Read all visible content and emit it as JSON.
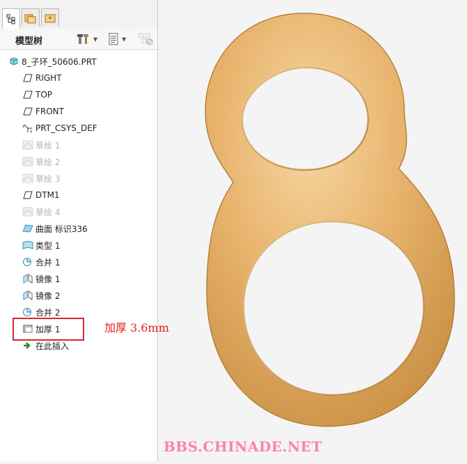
{
  "panel": {
    "tree_title": "模型树"
  },
  "tree": {
    "items": [
      {
        "label": "8_子环_50606.PRT",
        "icon": "part-icon",
        "dim": false
      },
      {
        "label": "RIGHT",
        "icon": "datum-plane-icon",
        "dim": false
      },
      {
        "label": "TOP",
        "icon": "datum-plane-icon",
        "dim": false
      },
      {
        "label": "FRONT",
        "icon": "datum-plane-icon",
        "dim": false
      },
      {
        "label": "PRT_CSYS_DEF",
        "icon": "csys-icon",
        "dim": false
      },
      {
        "label": "草绘 1",
        "icon": "sketch-icon",
        "dim": true
      },
      {
        "label": "草绘 2",
        "icon": "sketch-icon",
        "dim": true
      },
      {
        "label": "草绘 3",
        "icon": "sketch-icon",
        "dim": true
      },
      {
        "label": "DTM1",
        "icon": "datum-plane-icon",
        "dim": false
      },
      {
        "label": "草绘 4",
        "icon": "sketch-icon",
        "dim": true
      },
      {
        "label": "曲面 标识336",
        "icon": "surface-icon",
        "dim": false
      },
      {
        "label": "类型 1",
        "icon": "style-icon",
        "dim": false
      },
      {
        "label": "合并 1",
        "icon": "merge-icon",
        "dim": false
      },
      {
        "label": "镜像 1",
        "icon": "mirror-icon",
        "dim": false
      },
      {
        "label": "镜像 2",
        "icon": "mirror-icon",
        "dim": false
      },
      {
        "label": "合并 2",
        "icon": "merge-icon",
        "dim": false
      },
      {
        "label": "加厚 1",
        "icon": "thicken-icon",
        "dim": false
      },
      {
        "label": "在此插入",
        "icon": "insert-arrow-icon",
        "dim": false
      }
    ]
  },
  "annotation": "加厚 3.6mm",
  "watermark": "BBS.CHINADE.NET",
  "colors": {
    "highlight": "#d8262d",
    "annotation": "#e0201f",
    "watermark": "#ff80b0",
    "model": "#e3ab62"
  }
}
